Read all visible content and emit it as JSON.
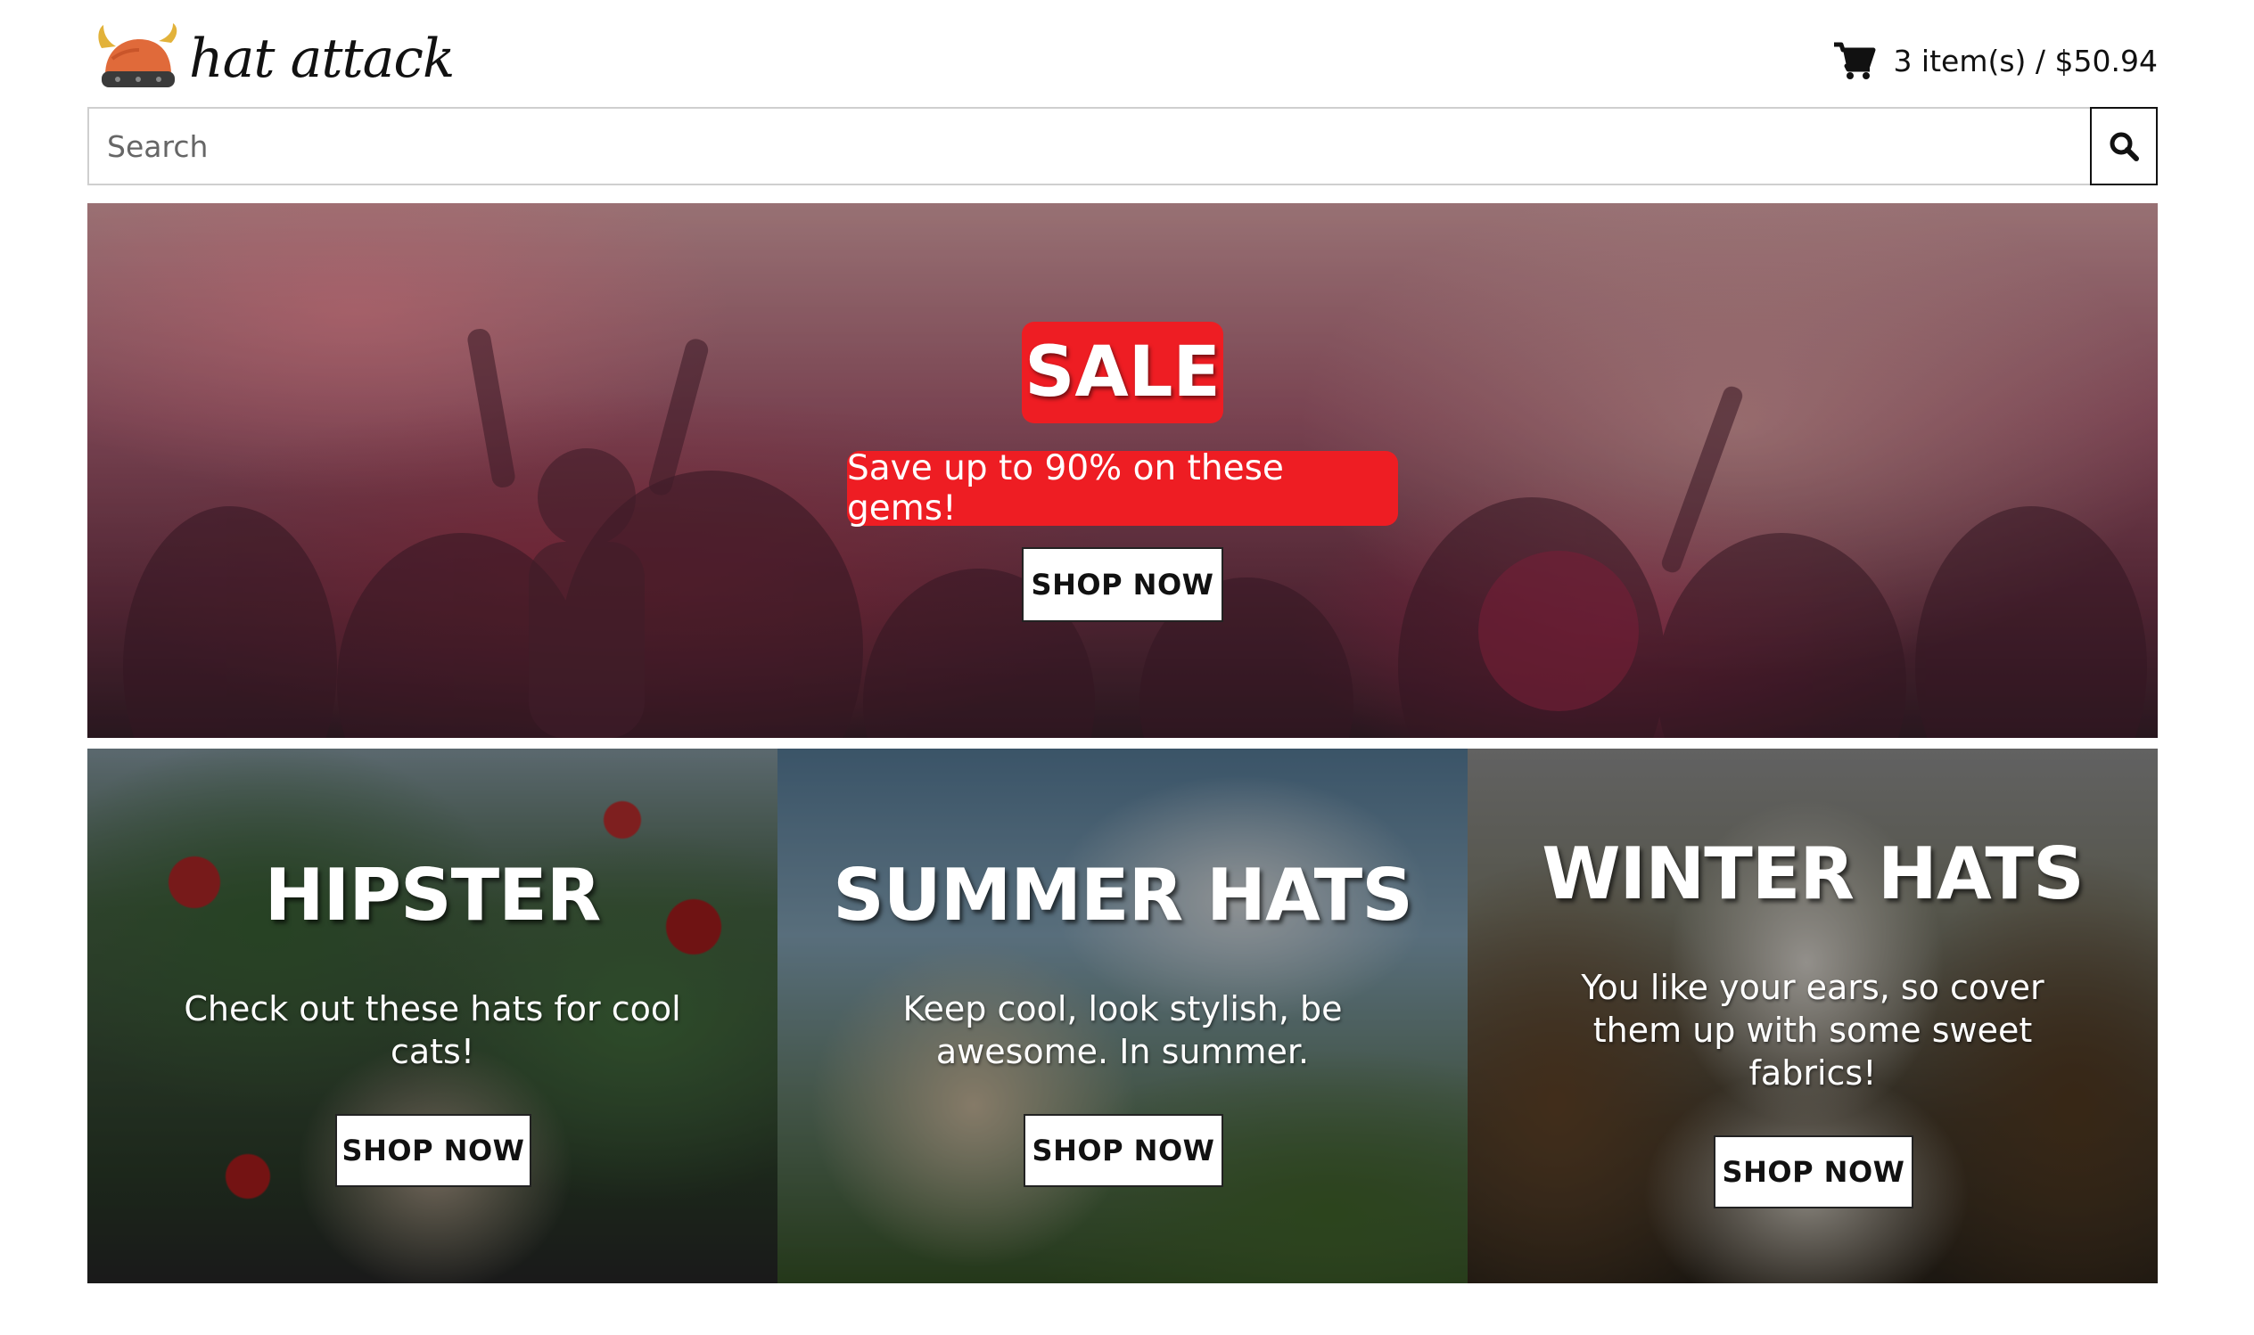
{
  "header": {
    "logo_text": "hat attack",
    "cart_summary": "3 item(s) / $50.94"
  },
  "search": {
    "placeholder": "Search"
  },
  "hero": {
    "badge": "SALE",
    "subtitle": "Save up to 90% on these gems!",
    "button": "SHOP NOW"
  },
  "categories": [
    {
      "title": "HIPSTER",
      "description": "Check out these hats for cool cats!",
      "button": "SHOP NOW"
    },
    {
      "title": "SUMMER HATS",
      "description": "Keep cool, look stylish, be awesome. In summer.",
      "button": "SHOP NOW"
    },
    {
      "title": "WINTER HATS",
      "description": "You like your ears, so cover them up with some sweet fabrics!",
      "button": "SHOP NOW"
    }
  ],
  "colors": {
    "accent_red": "#ee1d23",
    "button_bg": "#ffffff",
    "text_dark": "#111111"
  },
  "icons": {
    "logo": "viking-helmet-icon",
    "cart": "shopping-cart-icon",
    "search": "magnifier-icon"
  }
}
